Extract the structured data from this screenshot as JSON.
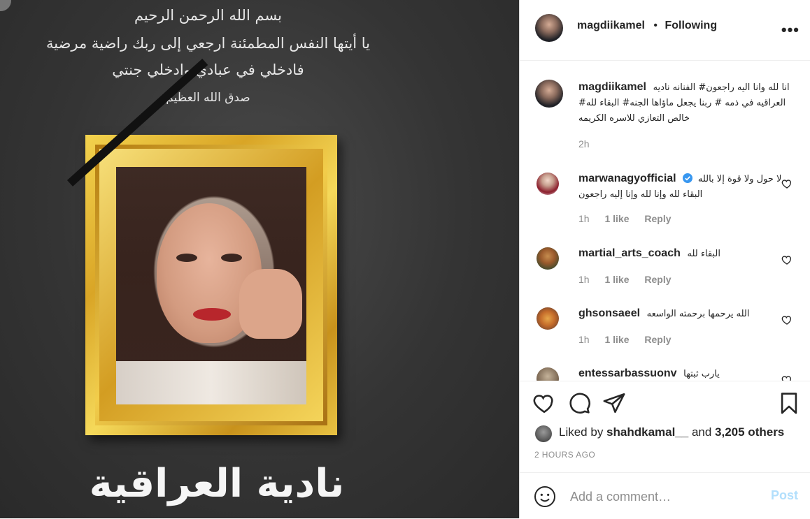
{
  "post_image": {
    "verse_lines": [
      "بسم الله الرحمن الرحيم",
      "يا أيتها النفس المطمئنة ارجعي إلى ربك راضية مرضية",
      "فادخلي في عبادي وادخلي جنتي",
      "صدق الله العظيم"
    ],
    "name": "نادية العراقية"
  },
  "header": {
    "username": "magdiikamel",
    "separator": "•",
    "follow_state": "Following",
    "more": "•••"
  },
  "caption": {
    "username": "magdiikamel",
    "text": "انا لله وانا اليه راجعون# الفنانه ناديه العراقيه في ذمه # ربنا يجعل ماؤاها الجنه# البقاء لله# خالص التعازي للاسره الكريمه",
    "time": "2h"
  },
  "comments": [
    {
      "username": "marwanagyofficial",
      "verified": true,
      "text": "لا حول ولا قوة إلا بالله البقاء لله وإنا لله وإنا إليه راجعون",
      "time": "1h",
      "likes": "1 like",
      "reply": "Reply"
    },
    {
      "username": "martial_arts_coach",
      "verified": false,
      "text": "البقاء لله",
      "time": "1h",
      "likes": "1 like",
      "reply": "Reply"
    },
    {
      "username": "ghsonsaeel",
      "verified": false,
      "text": "الله يرحمها برحمته الواسعه",
      "time": "1h",
      "likes": "1 like",
      "reply": "Reply"
    },
    {
      "username": "entessarbassuonv",
      "verified": false,
      "text": "يارب ثبتها",
      "time": "",
      "likes": "",
      "reply": ""
    }
  ],
  "likes_line": {
    "prefix": "Liked by ",
    "user": "shahdkamal__",
    "middle": " and ",
    "count": "3,205 others"
  },
  "post_time": "2 HOURS AGO",
  "add_comment": {
    "placeholder": "Add a comment…",
    "post_label": "Post"
  },
  "colors": {
    "verified": "#3897f0",
    "post_disabled": "#b2dffc",
    "meta_gray": "#8e8e8e"
  }
}
